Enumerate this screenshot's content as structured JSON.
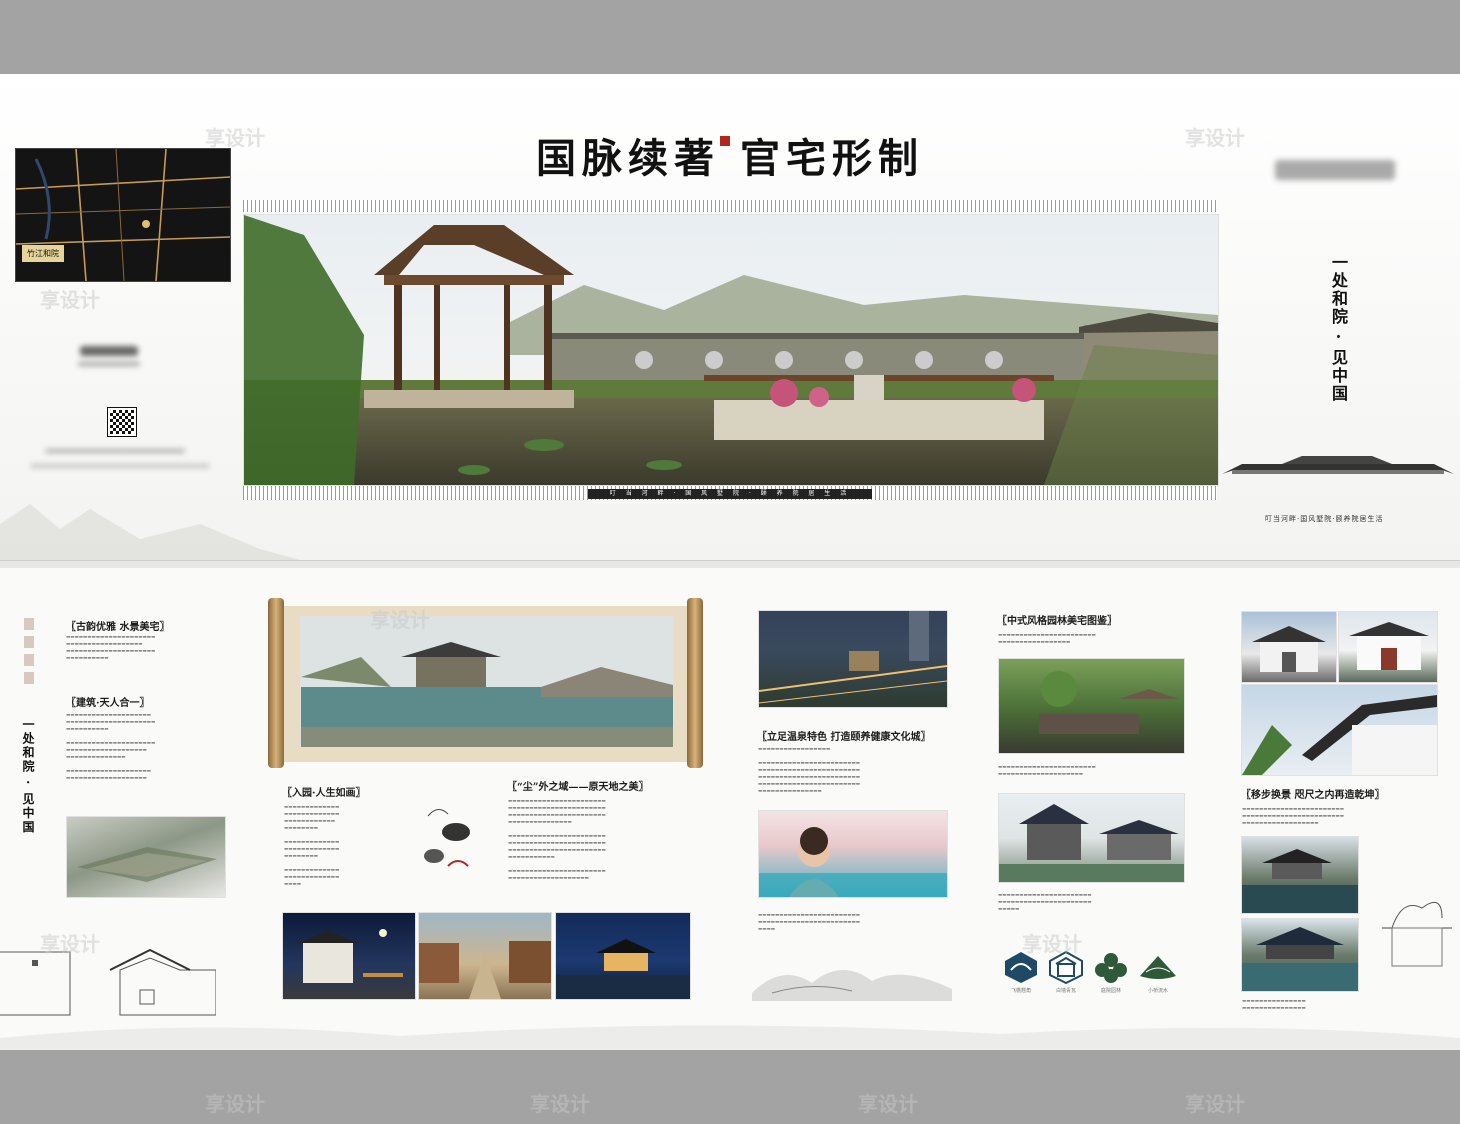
{
  "watermark": "享设计",
  "top_panel": {
    "title": "国脉续著 官宅形制",
    "image_caption": "叮 当 河 畔 · 国 风 墅 院 · 颐 养 院 居 生 活",
    "map_label": "竹江和院",
    "vertical_slogan": "一处和院 · 见中国",
    "right_tagline": "叮当河畔·国风墅院·颐养院居生活"
  },
  "bottom_panel": {
    "vertical_slogan": "一处和院 · 见中国",
    "sec1": "古韵优雅 水景美宅",
    "sec2": "建筑·天人合一",
    "sec3": "入园·人生如画",
    "sec4": "“尘”外之域——原天地之美",
    "sec5": "立足温泉特色 打造颐养健康文化城",
    "sec6": "中式风格园林美宅图鉴",
    "sec7": "移步换景 咫尺之内再造乾坤",
    "icons": [
      "飞檐翘角",
      "白墙青瓦",
      "庭院园林",
      "小桥流水"
    ]
  },
  "colors": {
    "ink": "#1d1d1d",
    "seal_red": "#b3261e",
    "band_gray": "#a3a3a3"
  }
}
